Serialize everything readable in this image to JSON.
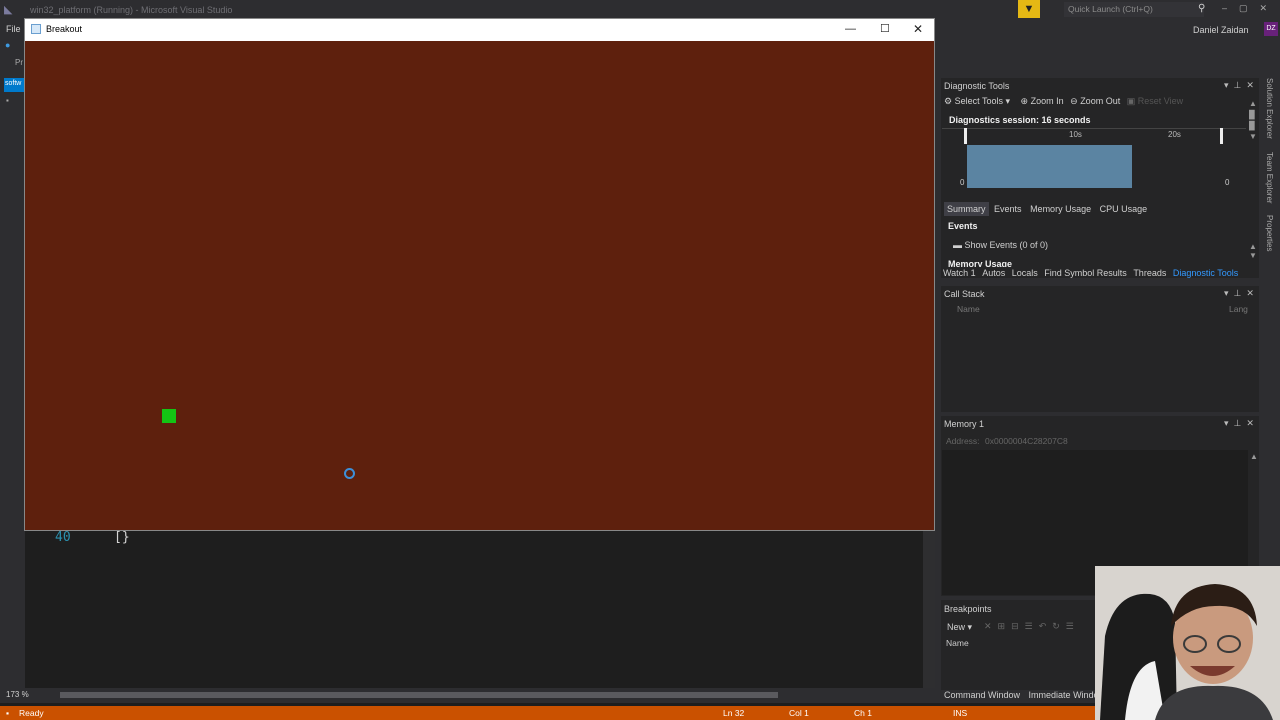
{
  "vs": {
    "window_title": "win32_platform (Running) - Microsoft Visual Studio",
    "menu_file": "File",
    "quick_launch_placeholder": "Quick Launch (Ctrl+Q)",
    "user_name": "Daniel Zaidan",
    "user_initials": "DZ",
    "left_tabs": [
      "Pr",
      "softw"
    ]
  },
  "editor": {
    "line_number": "40",
    "line_code": "[}",
    "zoom": "173 %"
  },
  "breakout": {
    "title": "Breakout",
    "background_color": "#5e200d",
    "player_color": "#14c414"
  },
  "diagnostic_tools": {
    "title": "Diagnostic Tools",
    "toolbar": {
      "select_tools": "Select Tools",
      "zoom_in": "Zoom In",
      "zoom_out": "Zoom Out",
      "reset_view": "Reset View"
    },
    "session_label": "Diagnostics session: 16 seconds",
    "ticks": [
      "10s",
      "20s"
    ],
    "y_min_left": "0",
    "y_min_right": "0",
    "tabs": [
      "Summary",
      "Events",
      "Memory Usage",
      "CPU Usage"
    ],
    "active_tab": "Summary",
    "events_heading": "Events",
    "show_events": "Show Events (0 of 0)",
    "memory_usage_heading": "Memory Usage"
  },
  "debug_tabs": [
    "Watch 1",
    "Autos",
    "Locals",
    "Find Symbol Results",
    "Threads",
    "Diagnostic Tools"
  ],
  "call_stack": {
    "title": "Call Stack",
    "col_name": "Name",
    "col_lang": "Lang"
  },
  "memory": {
    "title": "Memory 1",
    "address_label": "Address:",
    "address_value": "0x0000004C28207C8"
  },
  "breakpoints": {
    "title": "Breakpoints",
    "new_label": "New",
    "col_name": "Name"
  },
  "bottom_tabs": [
    "Command Window",
    "Immediate Windo"
  ],
  "right_vertical_tabs": [
    "Solution Explorer",
    "Team Explorer",
    "Properties"
  ],
  "statusbar": {
    "state": "Ready",
    "ln": "Ln 32",
    "col": "Col 1",
    "ch": "Ch 1",
    "ins": "INS",
    "color": "#ca5100"
  }
}
